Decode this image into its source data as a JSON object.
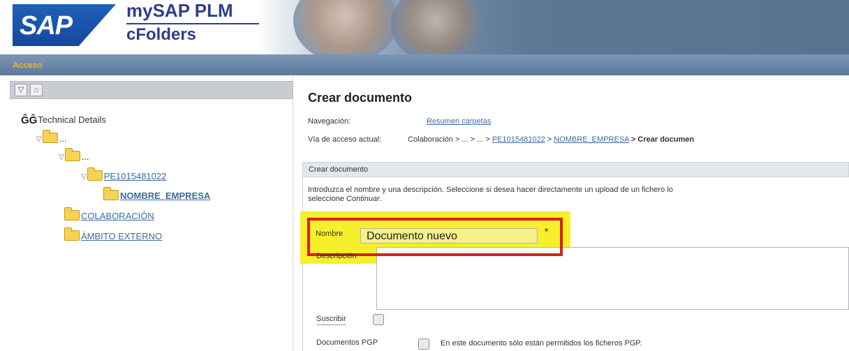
{
  "header": {
    "logo_text": "SAP",
    "product_line1": "mySAP PLM",
    "product_line2": "cFolders"
  },
  "accessbar": {
    "label": "Acceso"
  },
  "left_toolbar": {
    "collapse_icon": "collapse-icon",
    "home_icon": "home-icon",
    "collapse_glyph": "▽",
    "home_glyph": "⌂"
  },
  "tree": {
    "root_label": "Technical Details",
    "level1_label": "...",
    "level2_label": "...",
    "pe_label": "PE1015481022",
    "empresa_label": "NOMBRE_EMPRESA",
    "colaboracion_label": "COLABORACIÓN",
    "ambito_label": "ÁMBITO EXTERNO"
  },
  "main": {
    "title": "Crear documento",
    "nav_label": "Navegación:",
    "nav_link": "Resumen carpetas",
    "path_label": "Vía de acceso actual:",
    "path_prefix": "Colaboración > ... > ... >",
    "path_pe": "PE1015481022",
    "path_sep": ">",
    "path_empresa": "NOMBRE_EMPRESA",
    "path_suffix": "> Crear documen",
    "section_title": "Crear documento",
    "description_line1": "Introduzca el nombre y una descripción. Seleccione si desea hacer directamente un upload de un fichero lo",
    "description_line2_prefix": "seleccione ",
    "description_line2_em": "Continuar",
    "description_line2_suffix": "."
  },
  "form": {
    "name_label": "Nombre",
    "name_value": "Documento nuevo",
    "required_marker": "*",
    "description_label": "Descripción",
    "subscribe_label": "Suscribir",
    "pgp_label": "Documentos PGP",
    "pgp_hint": "En este documento sólo están permitidos los ficheros PGP."
  },
  "colors": {
    "accent_red": "#d5221a",
    "highlight_yellow": "#f7ef2c",
    "link_blue": "#3d6aa0",
    "access_orange": "#f0b428"
  }
}
